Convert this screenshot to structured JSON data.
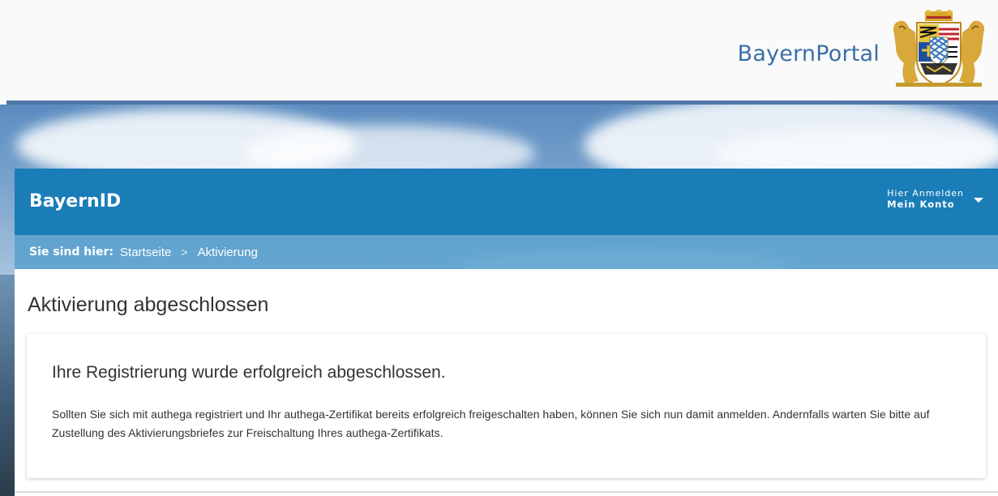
{
  "portal": {
    "title": "BayernPortal",
    "logo_icon": "bavarian-coat-of-arms-icon"
  },
  "nav": {
    "title": "BayernID",
    "login_line1": "Hier Anmelden",
    "login_line2": "Mein Konto",
    "login_icon": "chevron-down-icon"
  },
  "breadcrumb": {
    "label": "Sie sind hier:",
    "items": [
      "Startseite",
      "Aktivierung"
    ],
    "separator": ">"
  },
  "main": {
    "title": "Aktivierung abgeschlossen",
    "card": {
      "heading": "Ihre Registrierung wurde erfolgreich abgeschlossen.",
      "text": "Sollten Sie sich mit authega registriert und Ihr authega-Zertifikat bereits erfolgreich freigeschalten haben, können Sie sich nun damit anmelden. Andernfalls warten Sie bitte auf Zustellung des Aktivierungsbriefes zur Freischaltung Ihres authega-Zertifikats."
    }
  },
  "colors": {
    "nav_blue": "#1a7db8",
    "breadcrumb_blue": "#56a0cd",
    "portal_title_blue": "#3b6fa8",
    "divider_blue": "#4f79a8"
  }
}
